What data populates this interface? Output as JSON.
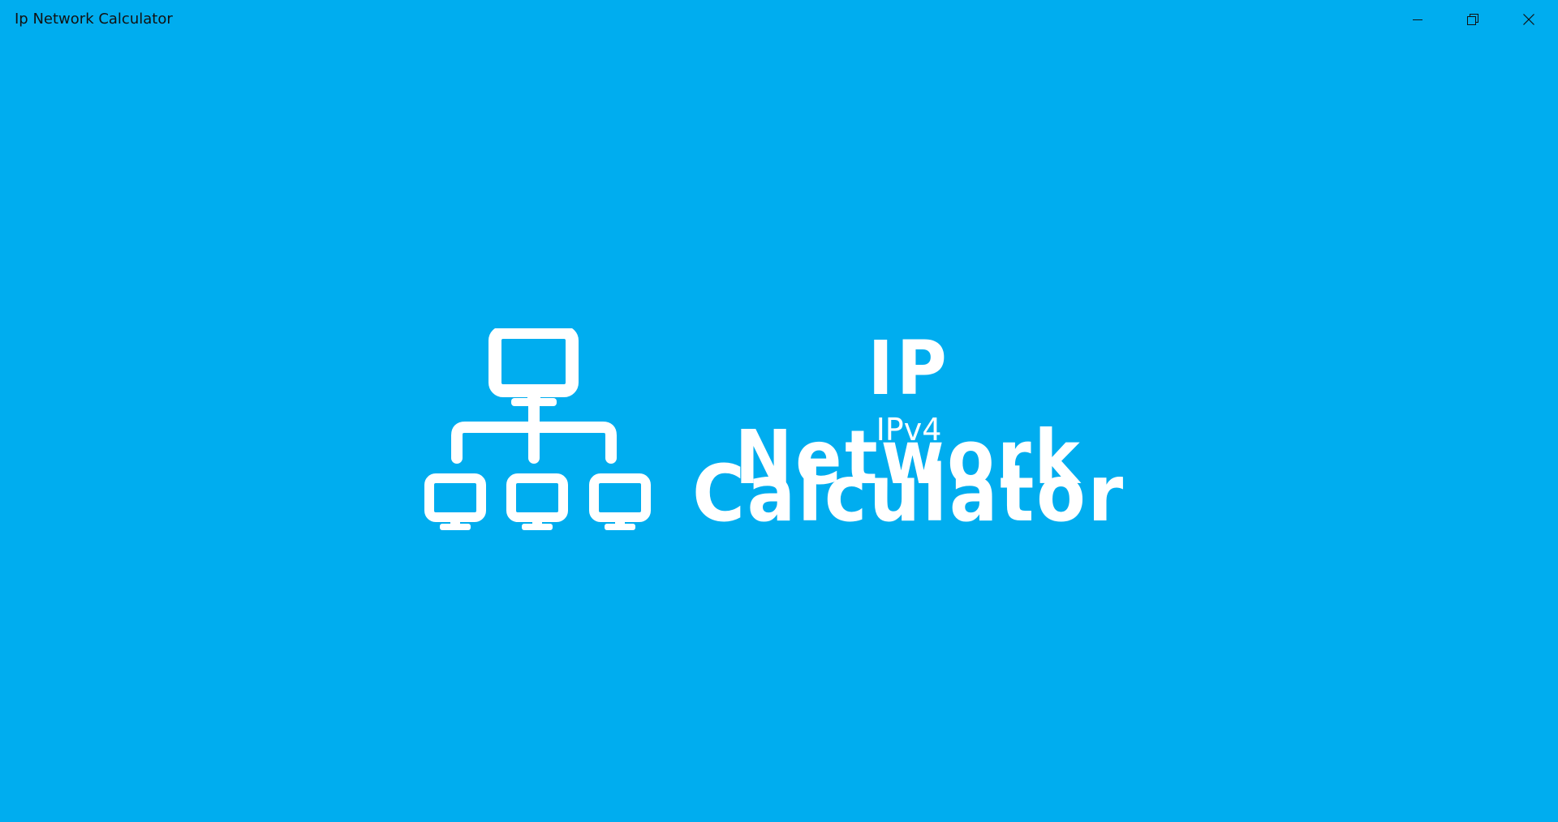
{
  "window": {
    "title": "Ip Network Calculator",
    "background_color": "#00adef",
    "controls": {
      "minimize_icon": "minimize-icon",
      "restore_icon": "restore-icon",
      "close_icon": "close-icon"
    }
  },
  "splash": {
    "icon": "network-topology-icon",
    "logo_line1": "IP Network",
    "logo_line2": "IPv4",
    "logo_line3": "Calculator",
    "text_color": "#ffffff"
  }
}
